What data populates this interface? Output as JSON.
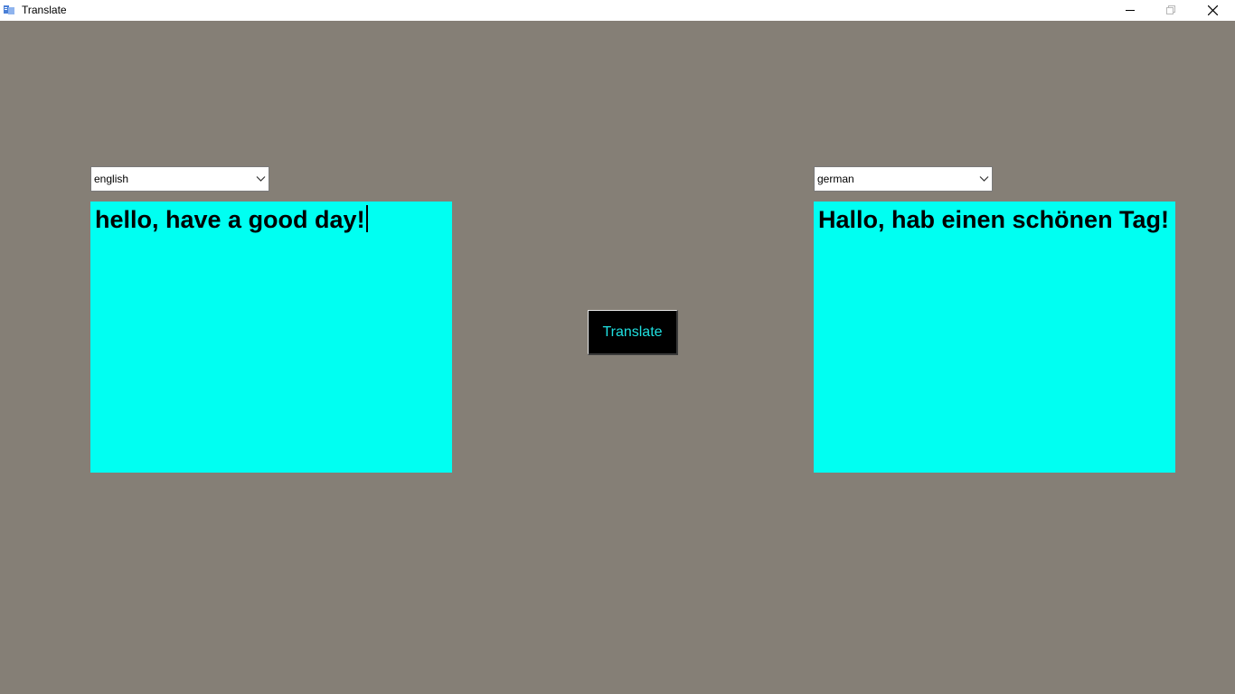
{
  "window": {
    "title": "Translate",
    "icon": "app-icon",
    "controls": [
      "minimize-icon",
      "maximize-icon",
      "close-icon"
    ]
  },
  "source": {
    "language": "english",
    "text": "hello, have a good day!"
  },
  "target": {
    "language": "german",
    "text": "Hallo, hab einen schönen Tag!"
  },
  "translate_button": {
    "label": "Translate"
  },
  "colors": {
    "background": "#857f76",
    "textbox": "#00fff2",
    "button_bg": "#000000",
    "button_text": "#1fdfe0"
  }
}
